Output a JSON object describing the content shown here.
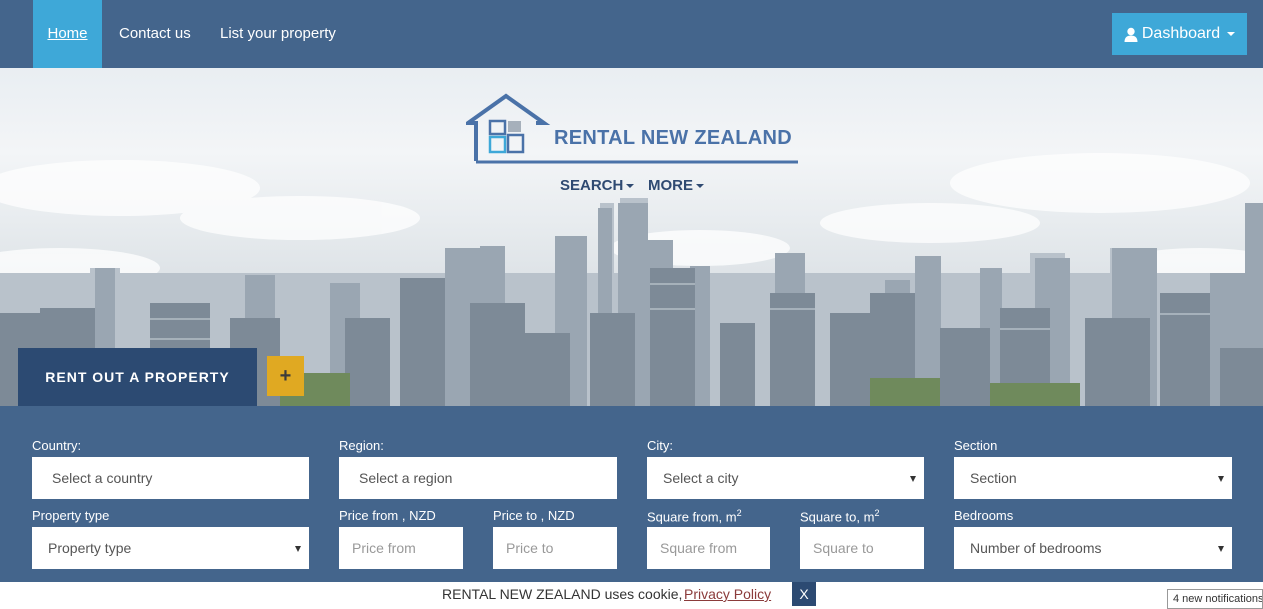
{
  "nav": {
    "home": "Home",
    "contact": "Contact us",
    "list_property": "List your property",
    "dashboard": "Dashboard"
  },
  "hero": {
    "brand": "RENTAL NEW ZEALAND",
    "menu_search": "SEARCH",
    "menu_more": "MORE",
    "rent_button": "RENT OUT A PROPERTY",
    "plus_button": "+"
  },
  "search": {
    "country_label": "Country:",
    "country_value": "Select a country",
    "region_label": "Region:",
    "region_value": "Select a region",
    "city_label": "City:",
    "city_value": "Select a city",
    "section_label": "Section",
    "section_value": "Section",
    "property_type_label": "Property type",
    "property_type_value": "Property type",
    "price_from_label": "Price from , NZD",
    "price_from_placeholder": "Price from",
    "price_to_label": "Price to , NZD",
    "price_to_placeholder": "Price to",
    "square_from_label": "Square from, m",
    "square_from_sup": "2",
    "square_from_placeholder": "Square from",
    "square_to_label": "Square to, m",
    "square_to_sup": "2",
    "square_to_placeholder": "Square to",
    "bedrooms_label": "Bedrooms",
    "bedrooms_value": "Number of bedrooms"
  },
  "cookie": {
    "text": "RENTAL NEW ZEALAND uses cookie,",
    "link": "Privacy Policy",
    "close": "X"
  },
  "notification": "4 new notifications",
  "colors": {
    "nav_bg": "#44658c",
    "accent": "#3ea8d8",
    "dark_blue": "#2c4a72",
    "brand_text": "#4a72a8",
    "plus_bg": "#e0a922"
  }
}
